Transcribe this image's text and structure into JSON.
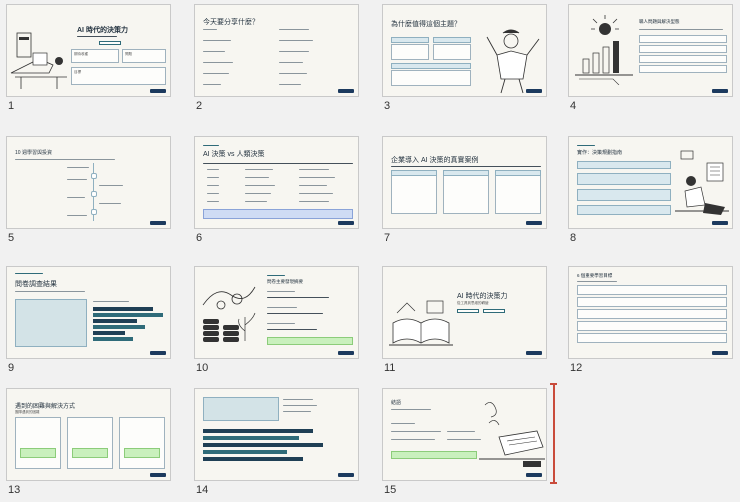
{
  "slides": [
    {
      "num": "1",
      "title": "AI 時代的決策力",
      "boxes": [
        "期待收穫",
        "問題",
        "目標"
      ]
    },
    {
      "num": "2",
      "title": "今天要分享什麼？"
    },
    {
      "num": "3",
      "title": "為什麼值得這個主題？"
    },
    {
      "num": "4",
      "title": "職人問題與解決型態"
    },
    {
      "num": "5",
      "title": "10 週學習與投資"
    },
    {
      "num": "6",
      "title": "AI 決策 vs 人類決策"
    },
    {
      "num": "7",
      "title": "企業導入 AI 決策的真實案例"
    },
    {
      "num": "8",
      "title": "實作：決策規劃指南"
    },
    {
      "num": "9",
      "title": "問卷調查結果"
    },
    {
      "num": "10",
      "title": "問卷主要發現摘要"
    },
    {
      "num": "11",
      "title": "AI 時代的決策力",
      "subtitle": "從工具到思維的轉變"
    },
    {
      "num": "12",
      "title": "6 個重要學習目標"
    },
    {
      "num": "13",
      "title": "遇到的困難與解決方式",
      "subtitle": "團隊遇到的困難"
    },
    {
      "num": "14",
      "title": ""
    },
    {
      "num": "15",
      "title": "結語"
    }
  ],
  "colors": {
    "accent": "#1c3a5e",
    "teal": "#2f6b79",
    "dark": "#1f3f55",
    "green": "#c9f0bd",
    "lightblue": "#d9e8ee",
    "cursor": "#c94b3b"
  }
}
